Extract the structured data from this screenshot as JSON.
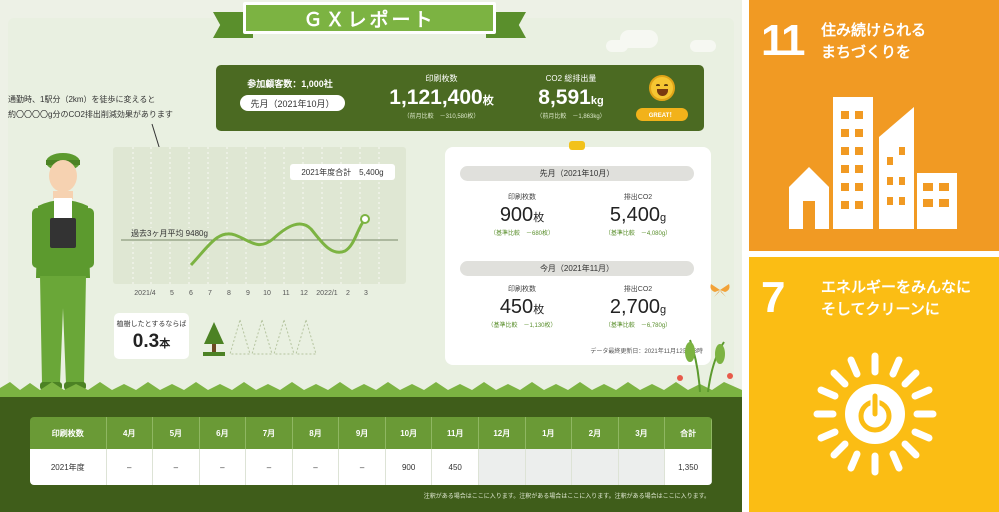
{
  "report": {
    "title": "ＧＸレポート",
    "speech_line1": "通勤時、1駅分（2km）を徒歩に変えると",
    "speech_line2": "約〇〇〇〇g分のCO2排出削減効果があります"
  },
  "stats_bar": {
    "participants": "参加顧客数：1,000社",
    "month": "先月（2021年10月）",
    "prints_label": "印刷枚数",
    "prints_value": "1,121,400",
    "prints_unit": "枚",
    "prints_sub": "（前月比較　－310,580枚）",
    "co2_label": "CO2 総排出量",
    "co2_value": "8,591",
    "co2_unit": "kg",
    "co2_sub": "（前月比較　－1,863kg）",
    "great": "GREAT！"
  },
  "chart": {
    "total_label": "2021年度合計　5,400g",
    "avg_label": "過去3ヶ月平均 9480g"
  },
  "chart_data": {
    "type": "line",
    "categories": [
      "2021/4",
      "5",
      "6",
      "7",
      "8",
      "9",
      "10",
      "11",
      "12",
      "2022/1",
      "2",
      "3"
    ],
    "series_shape": "smooth wave from 6 to 2022/1 with highlighted end point",
    "annotations": [
      "2021年度合計　5,400g",
      "過去3ヶ月平均 9480g"
    ]
  },
  "trees": {
    "label": "植樹したとするならば",
    "value": "0.3",
    "unit": "本"
  },
  "compare": {
    "last_month": "先月（2021年10月）",
    "this_month": "今月（2021年11月）",
    "prints_label": "印刷枚数",
    "co2_label": "排出CO2",
    "last_prints": "900",
    "last_prints_unit": "枚",
    "last_prints_sub": "（基準比較　－680枚）",
    "last_co2": "5,400",
    "last_co2_unit": "g",
    "last_co2_sub": "（基準比較　－4,080g）",
    "this_prints": "450",
    "this_prints_unit": "枚",
    "this_prints_sub": "（基準比較　－1,130枚）",
    "this_co2": "2,700",
    "this_co2_unit": "g",
    "this_co2_sub": "（基準比較　－6,780g）",
    "updated": "データ最終更新日：2021年11月12日 23時"
  },
  "table": {
    "headers": [
      "印刷枚数",
      "4月",
      "5月",
      "6月",
      "7月",
      "8月",
      "9月",
      "10月",
      "11月",
      "12月",
      "1月",
      "2月",
      "3月",
      "合計"
    ],
    "row": [
      "2021年度",
      "–",
      "–",
      "–",
      "–",
      "–",
      "–",
      "900",
      "450",
      "",
      "",
      "",
      "",
      "1,350"
    ]
  },
  "note": "注釈がある場合はここに入ります。注釈がある場合はここに入ります。注釈がある場合はここに入ります。",
  "sdg11": {
    "number": "11",
    "line1": "住み続けられる",
    "line2": "まちづくりを"
  },
  "sdg7": {
    "number": "7",
    "line1": "エネルギーをみんなに",
    "line2": "そしてクリーンに"
  },
  "colors": {
    "sdg11": "#f19a23",
    "sdg7": "#fbbd14",
    "brand_green": "#4b6a22"
  }
}
